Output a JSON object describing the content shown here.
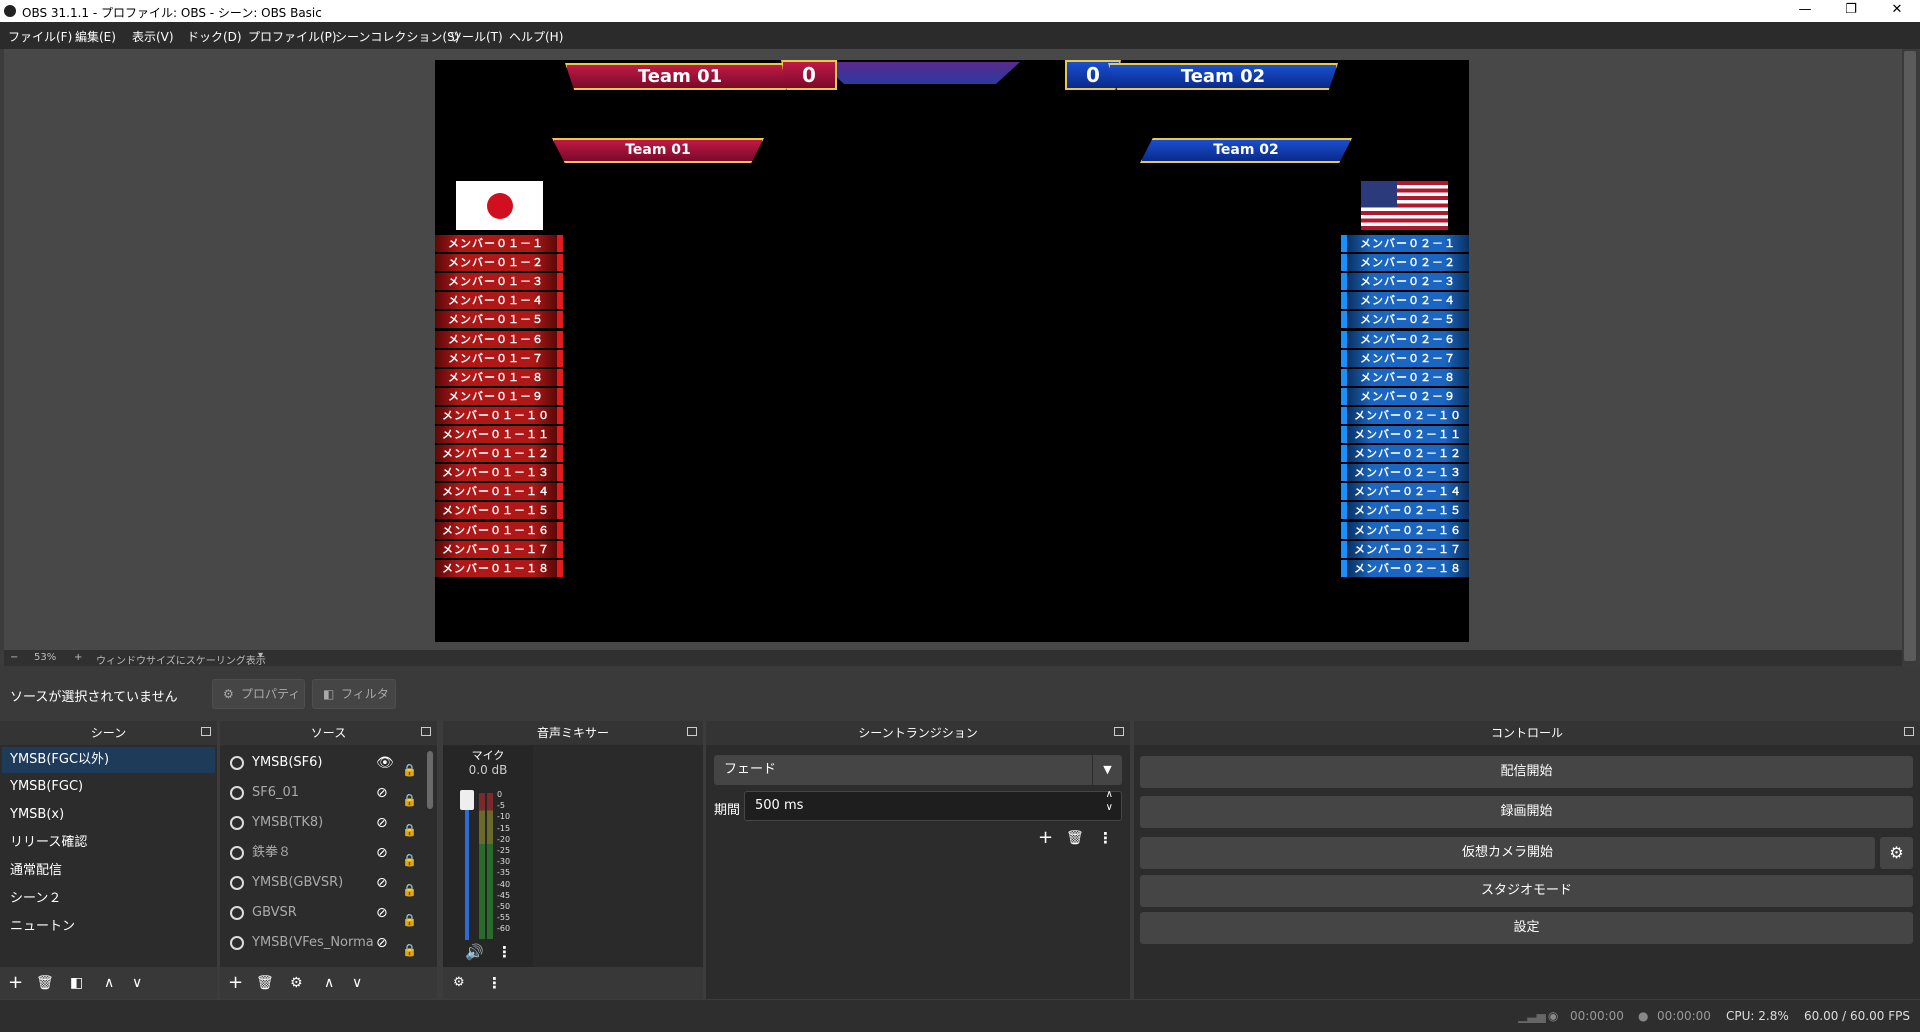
{
  "window": {
    "title": "OBS 31.1.1 - プロファイル: OBS - シーン: OBS Basic",
    "min": "—",
    "max": "❐",
    "close": "✕"
  },
  "menu": [
    "ファイル(F)",
    "編集(E)",
    "表示(V)",
    "ドック(D)",
    "プロファイル(P)",
    "シーンコレクション(S)",
    "ツール(T)",
    "ヘルプ(H)"
  ],
  "preview": {
    "team1_top": "Team 01",
    "team2_top": "Team 02",
    "score1": "0",
    "score2": "0",
    "team1_label": "Team 01",
    "team2_label": "Team 02",
    "team1_members": [
      "メンバー０１－１",
      "メンバー０１－２",
      "メンバー０１－３",
      "メンバー０１－４",
      "メンバー０１－５",
      "メンバー０１－６",
      "メンバー０１－７",
      "メンバー０１－８",
      "メンバー０１－９",
      "メンバー０１－１０",
      "メンバー０１－１１",
      "メンバー０１－１２",
      "メンバー０１－１３",
      "メンバー０１－１４",
      "メンバー０１－１５",
      "メンバー０１－１６",
      "メンバー０１－１７",
      "メンバー０１－１８"
    ],
    "team2_members": [
      "メンバー０２－１",
      "メンバー０２－２",
      "メンバー０２－３",
      "メンバー０２－４",
      "メンバー０２－５",
      "メンバー０２－６",
      "メンバー０２－７",
      "メンバー０２－８",
      "メンバー０２－９",
      "メンバー０２－１０",
      "メンバー０２－１１",
      "メンバー０２－１２",
      "メンバー０２－１３",
      "メンバー０２－１４",
      "メンバー０２－１５",
      "メンバー０２－１６",
      "メンバー０２－１７",
      "メンバー０２－１８"
    ]
  },
  "zoom": {
    "minus": "−",
    "value": "53%",
    "plus": "+",
    "mode": "ウィンドウサイズにスケーリング表示"
  },
  "selection": {
    "none": "ソースが選択されていません",
    "properties": "プロパティ",
    "filters": "フィルタ"
  },
  "scenes": {
    "title": "シーン",
    "items": [
      "YMSB(FGC以外)",
      "YMSB(FGC)",
      "YMSB(x)",
      "リリース確認",
      "通常配信",
      "シーン２",
      "ニュートン"
    ]
  },
  "sources": {
    "title": "ソース",
    "items": [
      {
        "name": "YMSB(SF6)",
        "visible": true
      },
      {
        "name": "SF6_01",
        "visible": false
      },
      {
        "name": "YMSB(TK8)",
        "visible": false
      },
      {
        "name": "鉄拳８",
        "visible": false
      },
      {
        "name": "YMSB(GBVSR)",
        "visible": false
      },
      {
        "name": "GBVSR",
        "visible": false
      },
      {
        "name": "YMSB(VFes_Norma",
        "visible": false
      }
    ]
  },
  "mixer": {
    "title": "音声ミキサー",
    "channel": "マイク",
    "level": "0.0 dB",
    "scale": [
      "0",
      "-5",
      "-10",
      "-15",
      "-20",
      "-25",
      "-30",
      "-35",
      "-40",
      "-45",
      "-50",
      "-55",
      "-60"
    ]
  },
  "transition": {
    "title": "シーントランジション",
    "type": "フェード",
    "duration_label": "期間",
    "duration": "500 ms"
  },
  "controls": {
    "title": "コントロール",
    "stream": "配信開始",
    "record": "録画開始",
    "virtual_cam": "仮想カメラ開始",
    "studio": "スタジオモード",
    "settings": "設定"
  },
  "status": {
    "stream_time": "00:00:00",
    "record_time": "00:00:00",
    "cpu": "CPU: 2.8%",
    "fps": "60.00 / 60.00 FPS"
  },
  "colors": {
    "accent_red": "#c01a45",
    "accent_blue": "#1a4fd0",
    "gold": "#e8c94a"
  }
}
